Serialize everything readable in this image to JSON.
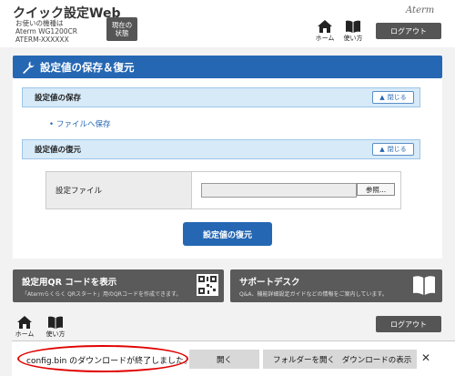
{
  "header": {
    "app_title": "クイック設定Web",
    "device_line1": "お使いの機種は",
    "device_line2": "Aterm WG1200CR",
    "device_line3": "ATERM-XXXXXX",
    "status_line1": "現在の",
    "status_line2": "状態",
    "home_label": "ホーム",
    "manual_label": "使い方",
    "logo": "Aterm",
    "logout_label": "ログアウト"
  },
  "page": {
    "title": "設定値の保存＆復元",
    "save_section": {
      "title": "設定値の保存",
      "close_label": "閉じる",
      "link_label": "ファイルへ保存"
    },
    "restore_section": {
      "title": "設定値の復元",
      "close_label": "閉じる",
      "file_label": "設定ファイル",
      "browse_label": "参照..."
    },
    "restore_button": "設定値の復元"
  },
  "cards": {
    "qr": {
      "title": "設定用QR コードを表示",
      "desc": "「Atermらくらく QRスタート」用のQRコードを作成できます。"
    },
    "support": {
      "title": "サポートデスク",
      "desc": "Q&A、機能詳細設定ガイドなどの情報をご案内しています。"
    }
  },
  "footer": {
    "home_label": "ホーム",
    "manual_label": "使い方",
    "logout_label": "ログアウト"
  },
  "download_bar": {
    "message": "config.bin のダウンロードが終了しました。",
    "open_label": "開く",
    "open_folder_label": "フォルダーを開く",
    "view_downloads_label": "ダウンロードの表示",
    "close_symbol": "✕"
  }
}
